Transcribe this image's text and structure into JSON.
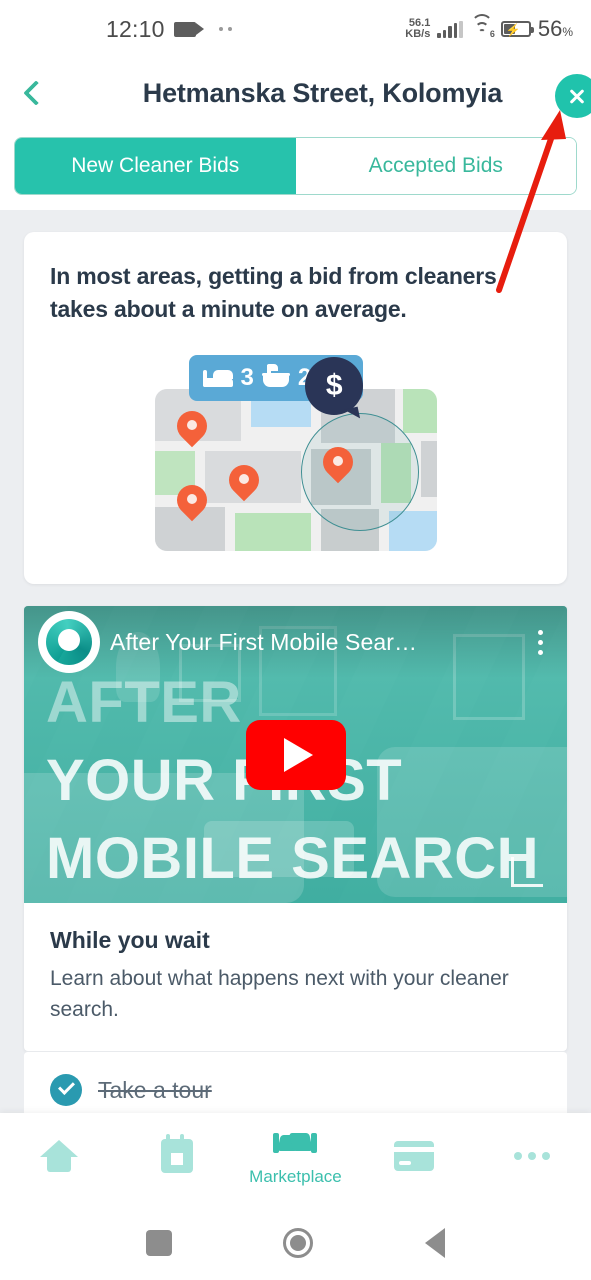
{
  "statusbar": {
    "time": "12:10",
    "video_icon": "video-camera-icon",
    "network_rate": "56.1",
    "network_rate_unit": "KB/s",
    "wifi_generation": "6",
    "battery_percent": "56",
    "percent_symbol": "%"
  },
  "header": {
    "title": "Hetmanska Street, Kolomyia",
    "back_icon": "chevron-left-icon",
    "close_icon": "close-icon"
  },
  "tabs": [
    {
      "label": "New Cleaner Bids",
      "active": true
    },
    {
      "label": "Accepted Bids",
      "active": false
    }
  ],
  "info_card": {
    "headline": "In most areas, getting a bid from cleaners takes about a minute on average.",
    "badge": {
      "bedrooms": "3",
      "bathrooms": "2",
      "price_icon": "dollar-icon"
    }
  },
  "video_card": {
    "youtube_title": "After Your First Mobile Sear…",
    "thumbnail_lines": [
      "AFTER",
      "YOUR FIRST",
      "MOBILE SEARCH"
    ],
    "play_icon": "play-button-icon",
    "menu_icon": "kebab-menu-icon",
    "avatar_icon": "channel-avatar-icon",
    "watch_later_icon": "corner-bracket-icon",
    "section_title": "While you wait",
    "section_desc": "Learn about what happens next with your cleaner search."
  },
  "tour_row": {
    "label": "Take a tour",
    "check_icon": "check-circle-icon",
    "completed": true
  },
  "bottom_nav": [
    {
      "name": "home",
      "label": "",
      "icon": "home-icon",
      "active": false
    },
    {
      "name": "calendar",
      "label": "",
      "icon": "calendar-icon",
      "active": false
    },
    {
      "name": "marketplace",
      "label": "Marketplace",
      "icon": "handshake-icon",
      "active": true
    },
    {
      "name": "payments",
      "label": "",
      "icon": "credit-card-icon",
      "active": false
    },
    {
      "name": "more",
      "label": "",
      "icon": "more-dots-icon",
      "active": false
    }
  ],
  "android_nav": [
    {
      "name": "recents",
      "icon": "square-icon"
    },
    {
      "name": "home",
      "icon": "circle-icon"
    },
    {
      "name": "back",
      "icon": "triangle-left-icon"
    }
  ],
  "annotation": {
    "type": "arrow",
    "color": "#e71d0e",
    "points_to": "close-button"
  },
  "colors": {
    "accent_teal": "#27c2ac",
    "nav_inactive": "#a8e3da",
    "nav_active": "#3bbfad",
    "title_dark": "#2b3a4a",
    "page_bg": "#eceef1",
    "badge_blue": "#5aa9d6",
    "badge_navy": "#2a3557",
    "pin_orange": "#f4613a",
    "youtube_red": "#ff0000"
  }
}
